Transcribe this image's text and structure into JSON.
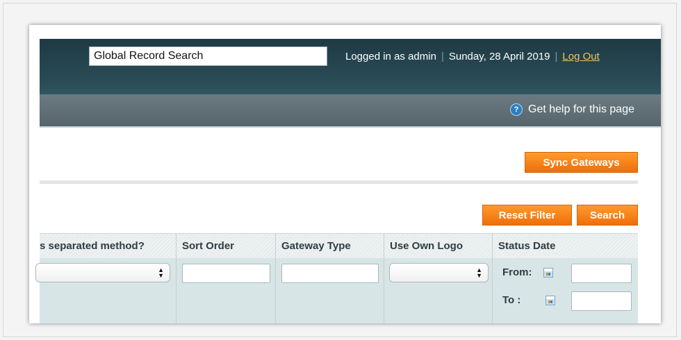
{
  "header": {
    "search_placeholder": "Global Record Search",
    "logged_in": "Logged in as admin",
    "separator": "|",
    "date": "Sunday, 28 April 2019",
    "logout": "Log Out"
  },
  "helpbar": {
    "help_text": "Get help for this page",
    "help_icon": "?"
  },
  "buttons": {
    "sync": "Sync Gateways",
    "reset": "Reset Filter",
    "search": "Search"
  },
  "grid": {
    "columns": [
      "s separated method?",
      "Sort Order",
      "Gateway Type",
      "Use Own Logo",
      "Status Date"
    ],
    "date_from": "From:",
    "date_to": "To :"
  },
  "colors": {
    "header_bg": "#2a4d58",
    "accent": "#f7861c",
    "logout_link": "#f2c560",
    "filter_bg": "#d7e5e6"
  }
}
